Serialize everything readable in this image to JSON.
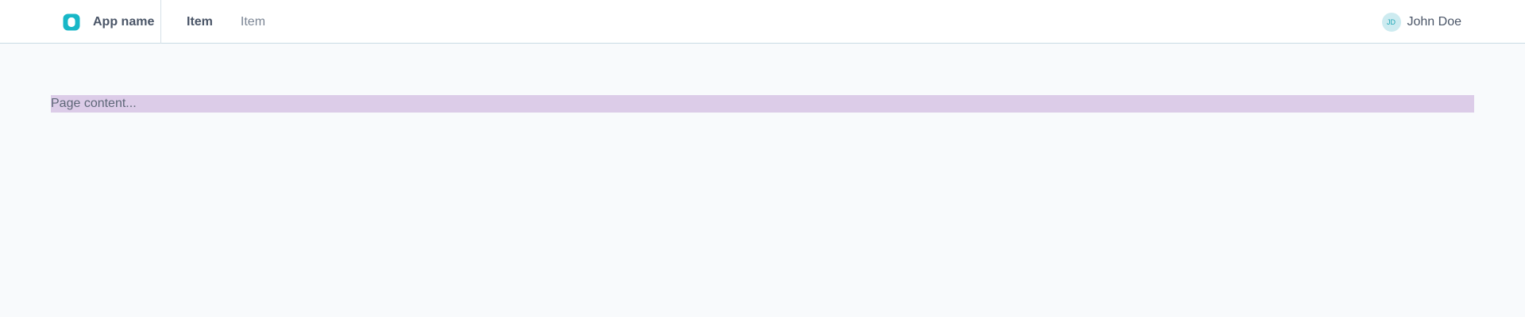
{
  "header": {
    "app_name": "App name",
    "logo_icon": "rounded-square-logo-icon",
    "nav_items": [
      {
        "label": "Item",
        "active": true
      },
      {
        "label": "Item",
        "active": false
      }
    ],
    "user": {
      "initials": "JD",
      "name": "John Doe"
    }
  },
  "main": {
    "content_text": "Page content..."
  },
  "colors": {
    "brand_accent": "#17b7c7",
    "header_background": "#ffffff",
    "page_background": "#f8fafc",
    "content_highlight": "#dccce8",
    "avatar_background": "#cdebf0"
  }
}
